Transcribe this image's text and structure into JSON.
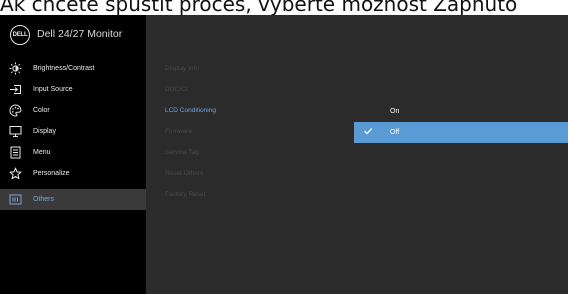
{
  "caption": "Ak chcete spustit proces, vyberte možnost Zapnuto",
  "header": {
    "logo_text": "DELL",
    "model": "Dell 24/27 Monitor"
  },
  "menu": [
    {
      "label": "Brightness/Contrast",
      "icon": "brightness-icon"
    },
    {
      "label": "Input Source",
      "icon": "input-source-icon"
    },
    {
      "label": "Color",
      "icon": "color-palette-icon"
    },
    {
      "label": "Display",
      "icon": "display-icon"
    },
    {
      "label": "Menu",
      "icon": "menu-icon"
    },
    {
      "label": "Personalize",
      "icon": "star-icon"
    },
    {
      "label": "Others",
      "icon": "others-icon",
      "active": true
    }
  ],
  "submenu": [
    {
      "label": "Display Info"
    },
    {
      "label": "DDC/CI"
    },
    {
      "label": "LCD Conditioning",
      "active": true
    },
    {
      "label": "Firmware"
    },
    {
      "label": "Service Tag"
    },
    {
      "label": "Reset Others"
    },
    {
      "label": "Factory Reset"
    }
  ],
  "options": [
    {
      "label": "On",
      "selected": false
    },
    {
      "label": "Off",
      "selected": true
    }
  ],
  "colors": {
    "accent": "#5b9bd5",
    "active_text": "#6fa3dd",
    "panel": "#2b2b2b",
    "sidebar": "#000000"
  }
}
